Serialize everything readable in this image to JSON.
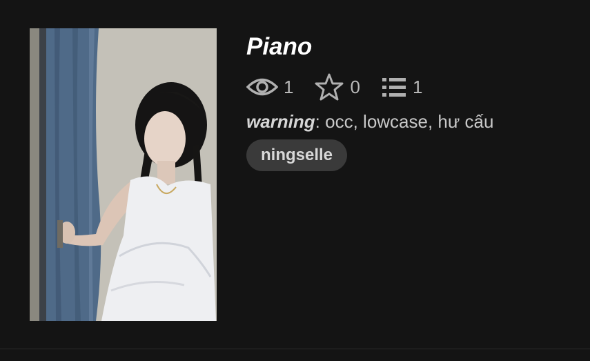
{
  "story": {
    "title": "Piano",
    "stats": {
      "views": "1",
      "votes": "0",
      "parts": "1"
    },
    "description": {
      "key": "warning",
      "separator": ":",
      "text": " occ, lowcase, hư cấu"
    },
    "tag": "ningselle"
  },
  "icons": {
    "views": "eye-icon",
    "votes": "star-icon",
    "parts": "list-icon"
  },
  "colors": {
    "background": "#141414",
    "title": "#ffffff",
    "text": "#c8c8c8",
    "tag_bg": "#3a3a3a"
  }
}
